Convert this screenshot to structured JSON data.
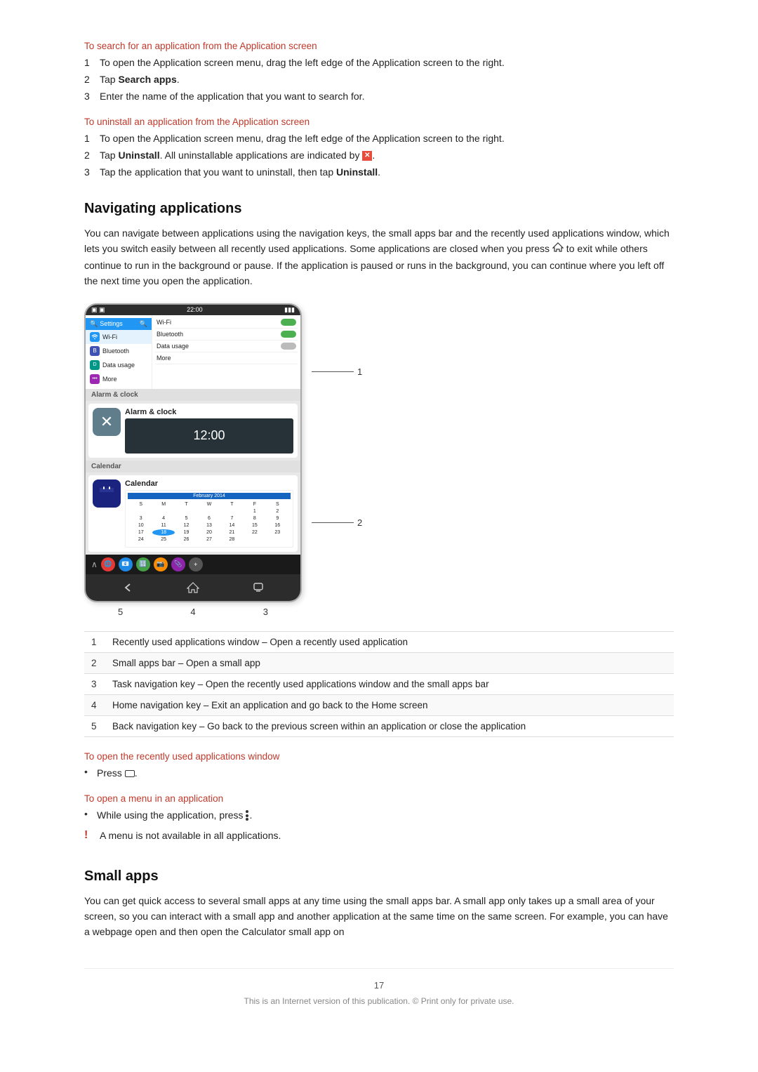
{
  "sections": {
    "search_section": {
      "title": "To search for an application from the Application screen",
      "steps": [
        "To open the Application screen menu, drag the left edge of the Application screen to the right.",
        "Tap Search apps.",
        "Enter the name of the application that you want to search for."
      ],
      "step2_label": "Search apps"
    },
    "uninstall_section": {
      "title": "To uninstall an application from the Application screen",
      "steps": [
        "To open the Application screen menu, drag the left edge of the Application screen to the right.",
        "Tap Uninstall. All uninstallable applications are indicated by",
        "Tap the application that you want to uninstall, then tap Uninstall."
      ],
      "step2_label": "Uninstall",
      "step3_label": "Uninstall"
    },
    "navigating": {
      "heading": "Navigating applications",
      "body": "You can navigate between applications using the navigation keys, the small apps bar and the recently used applications window, which lets you switch easily between all recently used applications. Some applications are closed when you press  to exit while others continue to run in the background or pause. If the application is paused or runs in the background, you can continue where you left off the next time you open the application."
    },
    "table": {
      "rows": [
        {
          "num": "1",
          "text": "Recently used applications window – Open a recently used application"
        },
        {
          "num": "2",
          "text": "Small apps bar – Open a small app"
        },
        {
          "num": "3",
          "text": "Task navigation key – Open the recently used applications window and the small apps bar"
        },
        {
          "num": "4",
          "text": "Home navigation key – Exit an application and go back to the Home screen"
        },
        {
          "num": "5",
          "text": "Back navigation key – Go back to the previous screen within an application or close the application"
        }
      ]
    },
    "recently_used": {
      "title": "To open the recently used applications window",
      "bullet": "Press"
    },
    "open_menu": {
      "title": "To open a menu in an application",
      "bullet": "While using the application, press",
      "warning": "A menu is not available in all applications."
    },
    "small_apps": {
      "heading": "Small apps",
      "body": "You can get quick access to several small apps at any time using the small apps bar. A small app only takes up a small area of your screen, so you can interact with a small app and another application at the same time on the same screen. For example, you can have a webpage open and then open the Calculator small app on"
    },
    "phone_screen": {
      "status_time": "22:00",
      "settings_items": [
        "Settings",
        "Wi-Fi",
        "Bluetooth",
        "Data usage",
        "More"
      ],
      "right_items": [
        {
          "label": "Wi-Fi",
          "enabled": true
        },
        {
          "label": "Bluetooth",
          "enabled": true
        },
        {
          "label": "Data usage",
          "enabled": false
        }
      ],
      "sections": [
        "Alarm & clock",
        "Calendar"
      ],
      "small_apps": [
        "🌐",
        "📧",
        "🔢",
        "📷",
        "📎"
      ],
      "nav_numbers": {
        "left": "5",
        "mid": "4",
        "right": "3"
      }
    },
    "callout_labels": {
      "c1": "1",
      "c2": "2"
    },
    "footer": {
      "page_number": "17",
      "legal": "This is an Internet version of this publication. © Print only for private use."
    }
  }
}
